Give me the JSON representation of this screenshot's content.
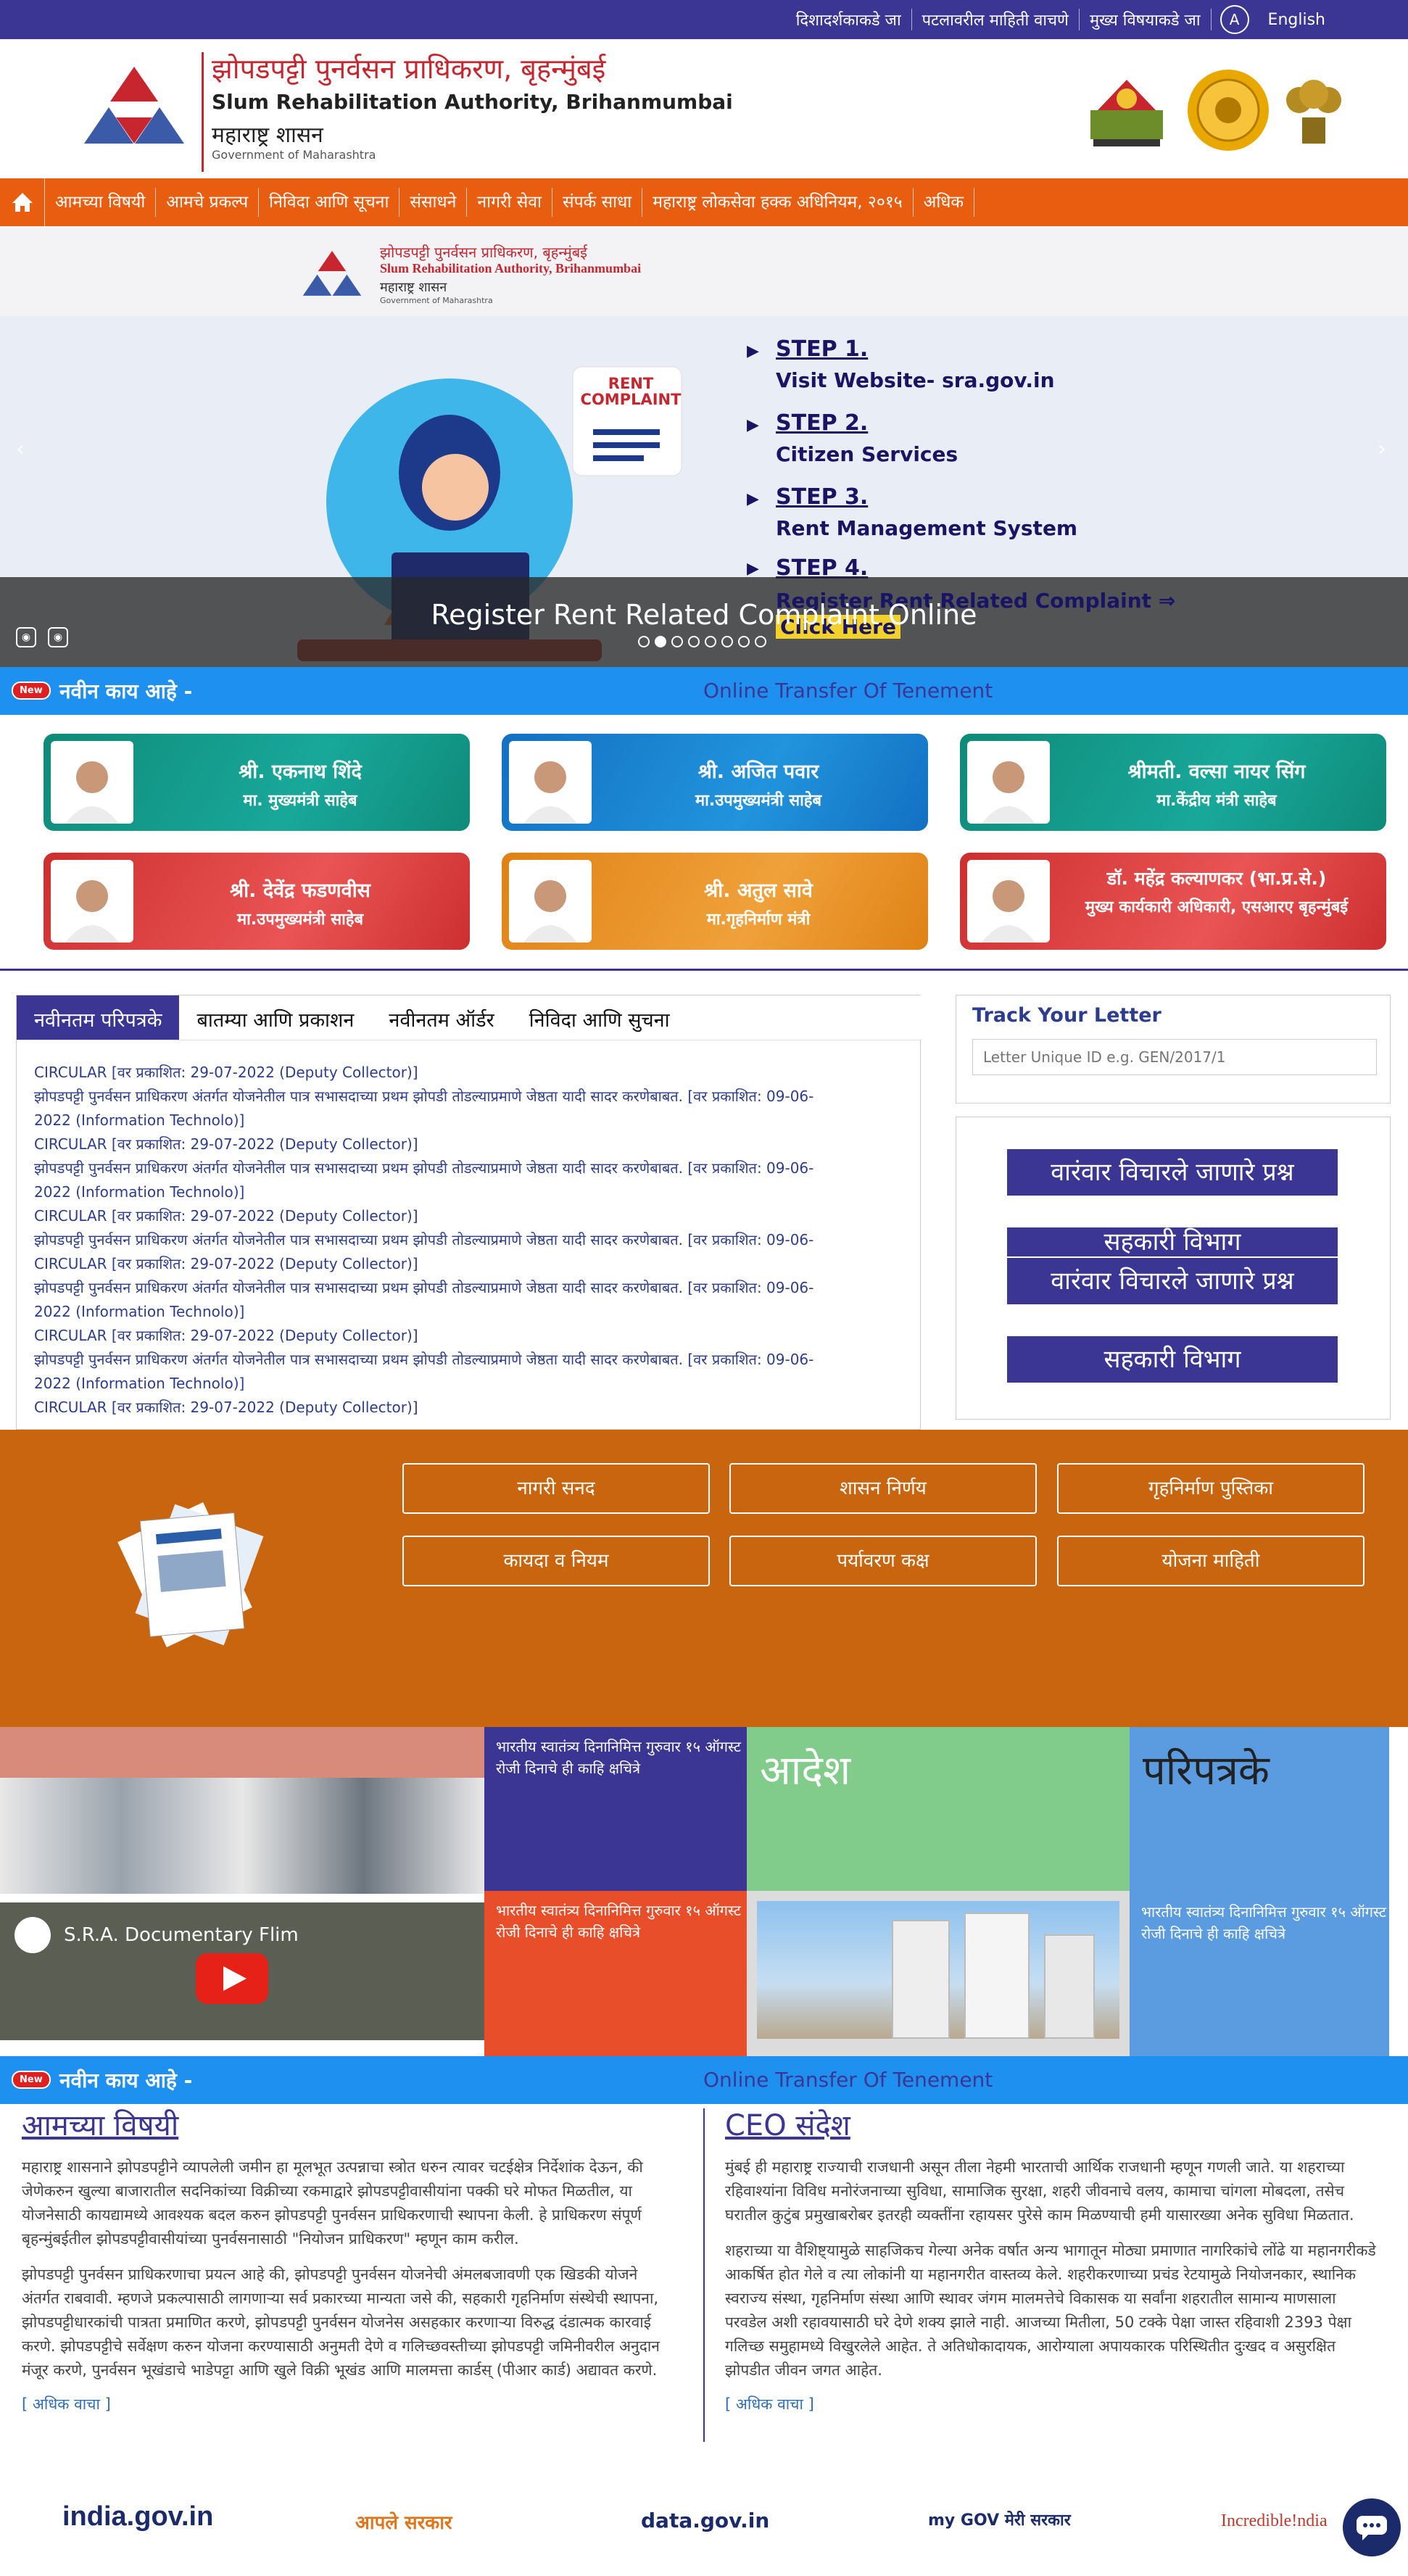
{
  "topbar": {
    "links": [
      "दिशादर्शकाकडे जा",
      "पटलावरील माहिती वाचणे",
      "मुख्य विषयाकडे जा"
    ],
    "accessibility": "A",
    "language": "English"
  },
  "header": {
    "title_mr": "झोपडपट्टी पुनर्वसन प्राधिकरण, बृहन्मुंबई",
    "title_en": "Slum Rehabilitation Authority, Brihanmumbai",
    "gov_mr": "महाराष्ट्र शासन",
    "gov_en": "Government of Maharashtra"
  },
  "nav": {
    "items": [
      "आमच्या विषयी",
      "आमचे प्रकल्प",
      "निविदा आणि सूचना",
      "संसाधने",
      "नागरी सेवा",
      "संपर्क साधा",
      "महाराष्ट्र लोकसेवा हक्क अधिनियम, २०१५",
      "अधिक"
    ]
  },
  "slider": {
    "banner_mr": "झोपडपट्टी पुनर्वसन प्राधिकरण, बृहन्मुंबई",
    "banner_en": "Slum Rehabilitation Authority, Brihanmumbai",
    "banner_gov": "महाराष्ट्र शासन",
    "banner_gom": "Government of Maharashtra",
    "rent_label": "RENT COMPLAINT",
    "steps": [
      {
        "h": "STEP 1.",
        "t": "Visit Website- sra.gov.in"
      },
      {
        "h": "STEP 2.",
        "t": "Citizen Services"
      },
      {
        "h": "STEP 3.",
        "t": "Rent Management System"
      },
      {
        "h": "STEP 4.",
        "t": "Register Rent Related Complaint ⇒"
      }
    ],
    "click_here": "Click Here",
    "caption": "Register Rent Related Complaint Online",
    "prev": "‹",
    "next": "›",
    "slide_count": 8,
    "active_slide": 2
  },
  "ticker": {
    "new_badge": "New",
    "label": "नवीन काय आहे -",
    "text": "Online Transfer Of Tenement"
  },
  "leaders": [
    {
      "name": "श्री. एकनाथ शिंदे",
      "title": "मा. मुख्यमंत्री साहेब",
      "color": "teal"
    },
    {
      "name": "श्री. अजित पवार",
      "title": "मा.उपमुख्यमंत्री साहेब",
      "color": "blue"
    },
    {
      "name": "श्रीमती. वल्सा नायर सिंग",
      "title": "मा.केंद्रीय मंत्री साहेब",
      "color": "teal"
    },
    {
      "name": "श्री. देवेंद्र फडणवीस",
      "title": "मा.उपमुख्यमंत्री साहेब",
      "color": "red"
    },
    {
      "name": "श्री. अतुल सावे",
      "title": "मा.गृहनिर्माण मंत्री",
      "color": "orange"
    },
    {
      "name": "डॉ. महेंद्र कल्याणकर (भा.प्र.से.)",
      "title": "मुख्य कार्यकारी अधिकारी, एसआरए बृहन्मुंबई",
      "color": "red"
    }
  ],
  "tabs": {
    "items": [
      "नवीनतम परिपत्रके",
      "बातम्या आणि प्रकाशन",
      "नवीनतम ऑर्डर",
      "निविदा आणि सुचना"
    ],
    "lines": [
      "CIRCULAR [वर प्रकाशित: 29-07-2022 (Deputy Collector)]",
      "झोपडपट्टी पुनर्वसन प्राधिकरण अंतर्गत योजनेतील पात्र सभासदाच्या प्रथम झोपडी तोडल्याप्रमाणे जेष्ठता यादी सादर करणेबाबत. [वर प्रकाशित: 09-06-",
      "2022 (Information Technolo)]",
      "CIRCULAR [वर प्रकाशित: 29-07-2022 (Deputy Collector)]",
      "झोपडपट्टी पुनर्वसन प्राधिकरण अंतर्गत योजनेतील पात्र सभासदाच्या प्रथम झोपडी तोडल्याप्रमाणे जेष्ठता यादी सादर करणेबाबत. [वर प्रकाशित: 09-06-",
      "2022 (Information Technolo)]",
      "CIRCULAR [वर प्रकाशित: 29-07-2022 (Deputy Collector)]",
      "झोपडपट्टी पुनर्वसन प्राधिकरण अंतर्गत योजनेतील पात्र सभासदाच्या प्रथम झोपडी तोडल्याप्रमाणे जेष्ठता यादी सादर करणेबाबत. [वर प्रकाशित: 09-06-",
      "CIRCULAR [वर प्रकाशित: 29-07-2022 (Deputy Collector)]",
      "झोपडपट्टी पुनर्वसन प्राधिकरण अंतर्गत योजनेतील पात्र सभासदाच्या प्रथम झोपडी तोडल्याप्रमाणे जेष्ठता यादी सादर करणेबाबत. [वर प्रकाशित: 09-06-",
      "2022 (Information Technolo)]",
      "CIRCULAR [वर प्रकाशित: 29-07-2022 (Deputy Collector)]",
      "झोपडपट्टी पुनर्वसन प्राधिकरण अंतर्गत योजनेतील पात्र सभासदाच्या प्रथम झोपडी तोडल्याप्रमाणे जेष्ठता यादी सादर करणेबाबत. [वर प्रकाशित: 09-06-",
      "2022 (Information Technolo)]",
      "CIRCULAR [वर प्रकाशित: 29-07-2022 (Deputy Collector)]"
    ]
  },
  "track": {
    "title": "Track Your Letter",
    "placeholder": "Letter Unique ID e.g. GEN/2017/1"
  },
  "quicklinks": [
    "वारंवार विचारले जाणारे प्रश्न",
    "सहकारी विभाग",
    "वारंवार विचारले जाणारे प्रश्न",
    "सहकारी विभाग"
  ],
  "resources": [
    "नागरी सनद",
    "शासन निर्णय",
    "गृहनिर्माण पुस्तिका",
    "कायदा व नियम",
    "पर्यावरण कक्ष",
    "योजना माहिती"
  ],
  "media": {
    "news1": "भारतीय स्वातंत्र्य दिनानिमित्त गुरुवार १५ ऑगस्ट रोजी दिनाचे ही काहि क्षचित्रे",
    "news2": "भारतीय स्वातंत्र्य दिनानिमित्त गुरुवार १५ ऑगस्ट रोजी दिनाचे ही काहि क्षचित्रे",
    "news3": "भारतीय स्वातंत्र्य दिनानिमित्त गुरुवार १५ ऑगस्ट रोजी दिनाचे ही काहि क्षचित्रे",
    "orders": "आदेश",
    "circulars": "परिपत्रके",
    "video_title": "S.R.A. Documentary Flim"
  },
  "ticker2": {
    "new_badge": "New",
    "label": "नवीन काय आहे -",
    "text": "Online Transfer Of Tenement"
  },
  "about": {
    "title": "आमच्या विषयी",
    "p1": "महाराष्ट्र शासनाने झोपडपट्टीने व्यापलेली जमीन हा मूलभूत उत्पन्नाचा स्त्रोत धरुन त्यावर चटईक्षेत्र निर्देशांक देऊन, की जेणेकरुन खुल्या बाजारातील सदनिकांच्या विक्रीच्या रकमाद्वारे झोपडपट्टीवासीयांना पक्की घरे मोफत मिळतील, या योजनेसाठी कायद्यामध्ये आवश्यक बदल करुन झोपडपट्टी पुनर्वसन प्राधिकरणाची स्थापना केली. हे प्राधिकरण संपूर्ण बृहन्मुंबईतील झोपडपट्टीवासीयांच्या पुनर्वसनासाठी \"नियोजन प्राधिकरण\" म्हणून काम करील.",
    "p2": "झोपडपट्टी पुनर्वसन प्राधिकरणाचा प्रयत्न आहे की, झोपडपट्टी पुनर्वसन योजनेची अंमलबजावणी एक खिडकी योजने अंतर्गत राबवावी. म्हणजे प्रकल्पासाठी लागणाऱ्या सर्व प्रकारच्या मान्यता जसे की, सहकारी गृहनिर्माण संस्थेची स्थापना, झोपडपट्टीधारकांची पात्रता प्रमाणित करणे, झोपडपट्टी पुनर्वसन योजनेस असहकार करणाऱ्या विरुद्ध दंडात्मक कारवाई करणे. झोपडपट्टीचे सर्वेक्षण करुन योजना करण्यासाठी अनुमती देणे व गलिच्छवस्तीच्या झोपडपट्टी जमिनीवरील अनुदान मंजूर करणे, पुनर्वसन भूखंडाचे भाडेपट्टा आणि खुले विक्री भूखंड आणि मालमत्ता कार्डस् (पीआर कार्ड) अद्यावत करणे.",
    "more": "[ अधिक वाचा ]"
  },
  "ceo": {
    "title": "CEO संदेश",
    "p1": "मुंबई ही महाराष्ट्र राज्याची राजधानी असून तीला नेहमी भारताची आर्थिक राजधानी म्हणून गणली जाते. या शहराच्या रहिवाश्यांना विविध मनोरंजनाच्या सुविधा, सामाजिक सुरक्षा, शहरी जीवनाचे वलय, कामाचा चांगला मोबदला, तसेच घरातील कुटुंब प्रमुखाबरोबर इतरही व्यक्तींना रहायसर पुरेसे काम मिळण्याची हमी यासारख्या अनेक सुविधा मिळतात.",
    "p2": "शहराच्या या वैशिष्ट्यामुळे साहजिकच गेल्या अनेक वर्षात अन्य भागातून मोठ्या प्रमाणात नागरिकांचे लोंढे या महानगरीकडे आकर्षित होत गेले व त्या लोकांनी या महानगरीत वास्तव्य केले. शहरीकरणाच्या प्रचंड रेटयामुळे नियोजनकार, स्थानिक स्वराज्य संस्था, गृहनिर्माण संस्था आणि स्थावर जंगम मालमत्तेचे विकासक या सर्वांना शहरातील सामान्य माणसाला परवडेल अशी रहावयासाठी घरे देणे शक्य झाले नाही. आजच्या मितीला, 50 टक्के पेक्षा जास्त रहिवाशी 2393 पेक्षा गलिच्छ समुहामध्ये विखुरलेले आहेत. ते अतिधोकादायक, आरोग्याला अपायकारक परिस्थितीत दुःखद व असुरक्षित झोपडीत जीवन जगत आहेत.",
    "more": "[ अधिक वाचा ]"
  },
  "partners": {
    "india": "india.gov.in",
    "aaple": "आपले सरकार",
    "datagov": "data.gov.in",
    "mygov": "my GOV मेरी सरकार",
    "incredible": "Incredible!ndia"
  },
  "colors": {
    "primary": "#3b3693",
    "nav_orange": "#e95d10",
    "resources_orange": "#c9650f",
    "ticker_blue": "#1e90ef"
  }
}
